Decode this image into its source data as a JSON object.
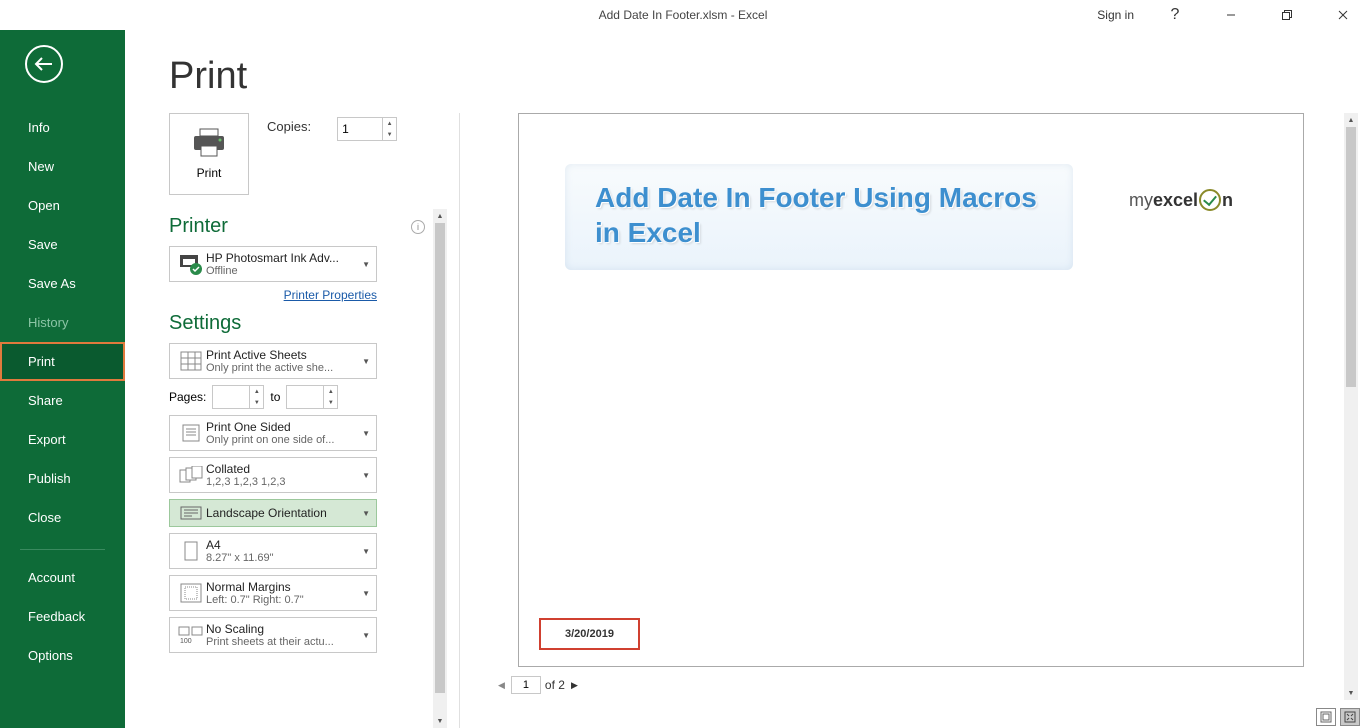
{
  "titlebar": {
    "title": "Add Date In Footer.xlsm  -  Excel",
    "signin": "Sign in"
  },
  "sidebar": {
    "items": [
      {
        "label": "Info"
      },
      {
        "label": "New"
      },
      {
        "label": "Open"
      },
      {
        "label": "Save"
      },
      {
        "label": "Save As"
      },
      {
        "label": "History",
        "dim": true
      },
      {
        "label": "Print",
        "highlighted": true
      },
      {
        "label": "Share"
      },
      {
        "label": "Export"
      },
      {
        "label": "Publish"
      },
      {
        "label": "Close"
      }
    ],
    "footer": [
      {
        "label": "Account"
      },
      {
        "label": "Feedback"
      },
      {
        "label": "Options"
      }
    ]
  },
  "page_title": "Print",
  "print": {
    "button_label": "Print",
    "copies_label": "Copies:",
    "copies_value": "1"
  },
  "printer": {
    "heading": "Printer",
    "name": "HP Photosmart Ink Adv...",
    "status": "Offline",
    "properties_link": "Printer Properties"
  },
  "settings": {
    "heading": "Settings",
    "what": {
      "line1": "Print Active Sheets",
      "line2": "Only print the active she..."
    },
    "pages_label": "Pages:",
    "pages_from": "",
    "pages_to_label": "to",
    "pages_to": "",
    "sides": {
      "line1": "Print One Sided",
      "line2": "Only print on one side of..."
    },
    "collate": {
      "line1": "Collated",
      "line2": "1,2,3    1,2,3    1,2,3"
    },
    "orientation": {
      "line1": "Landscape Orientation"
    },
    "paper": {
      "line1": "A4",
      "line2": "8.27\" x 11.69\""
    },
    "margins": {
      "line1": "Normal Margins",
      "line2": "Left:   0.7\"    Right:   0.7\""
    },
    "scaling": {
      "line1": "No Scaling",
      "line2": "Print sheets at their actu..."
    }
  },
  "preview": {
    "doc_title": "Add Date In Footer Using Macros in Excel",
    "logo_prefix": "my",
    "logo_mid": "excel",
    "logo_suffix": "n",
    "footer_date": "3/20/2019"
  },
  "page_nav": {
    "current": "1",
    "of": "of 2"
  }
}
